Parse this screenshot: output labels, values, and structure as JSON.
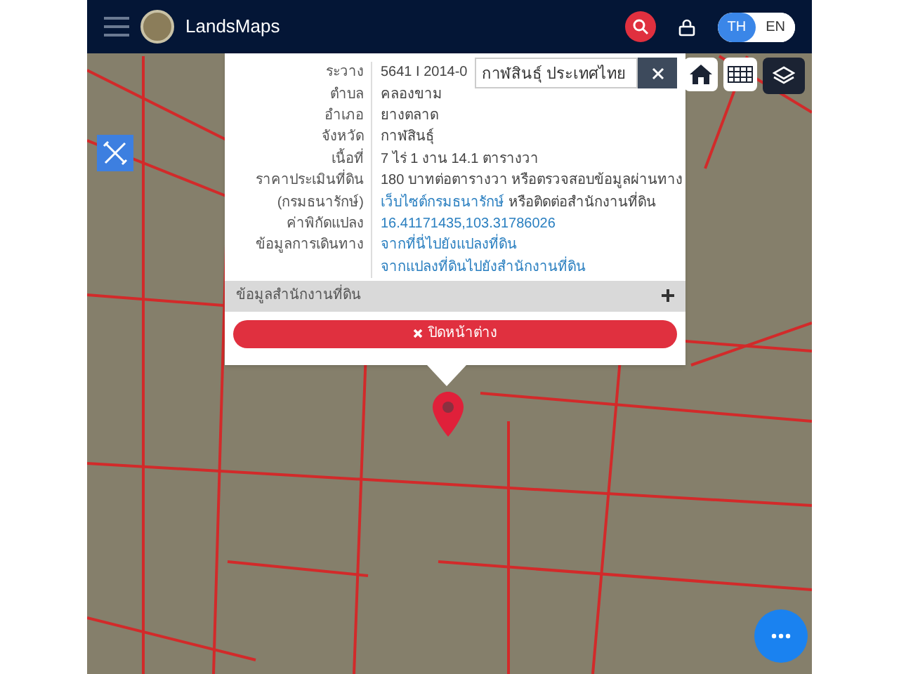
{
  "header": {
    "app_name": "LandsMaps",
    "languages": [
      {
        "label": "TH",
        "selected": true
      },
      {
        "label": "EN",
        "selected": false
      }
    ]
  },
  "search": {
    "value": "กาฬสินธุ์ ประเทศไทย"
  },
  "info_rows": [
    {
      "label": "ระวาง",
      "segments": [
        {
          "text": "5641 I 2014-0",
          "kind": "plain"
        }
      ]
    },
    {
      "label": "ตำบล",
      "segments": [
        {
          "text": "คลองขาม",
          "kind": "plain"
        }
      ]
    },
    {
      "label": "อำเภอ",
      "segments": [
        {
          "text": "ยางตลาด",
          "kind": "plain"
        }
      ]
    },
    {
      "label": "จังหวัด",
      "segments": [
        {
          "text": "กาฬสินธุ์",
          "kind": "plain"
        }
      ]
    },
    {
      "label": "เนื้อที่",
      "segments": [
        {
          "text": "7 ไร่ 1 งาน 14.1 ตารางวา",
          "kind": "plain"
        }
      ]
    },
    {
      "label": "ราคาประเมินที่ดิน",
      "segments": [
        {
          "text": "180 บาทต่อตารางวา หรือตรวจสอบข้อมูลผ่านทาง",
          "kind": "plain"
        }
      ]
    },
    {
      "label": "(กรมธนารักษ์)",
      "segments": [
        {
          "text": "เว็บไซต์กรมธนารักษ์",
          "kind": "link"
        },
        {
          "text": "หรือติดต่อสำนักงานที่ดิน",
          "kind": "plain"
        }
      ]
    },
    {
      "label": "ค่าพิกัดแปลง",
      "segments": [
        {
          "text": "16.41171435,103.31786026",
          "kind": "link"
        }
      ]
    },
    {
      "label": "ข้อมูลการเดินทาง",
      "segments": [
        {
          "text": "จากที่นี่ไปยังแปลงที่ดิน",
          "kind": "link"
        }
      ]
    },
    {
      "segments": [
        {
          "text": "จากแปลงที่ดินไปยังสำนักงานที่ดิน",
          "kind": "link"
        }
      ]
    }
  ],
  "section": {
    "title": "ข้อมูลสำนักงานที่ดิน",
    "expanded": false
  },
  "close_button": {
    "label": "ปิดหน้าต่าง"
  }
}
